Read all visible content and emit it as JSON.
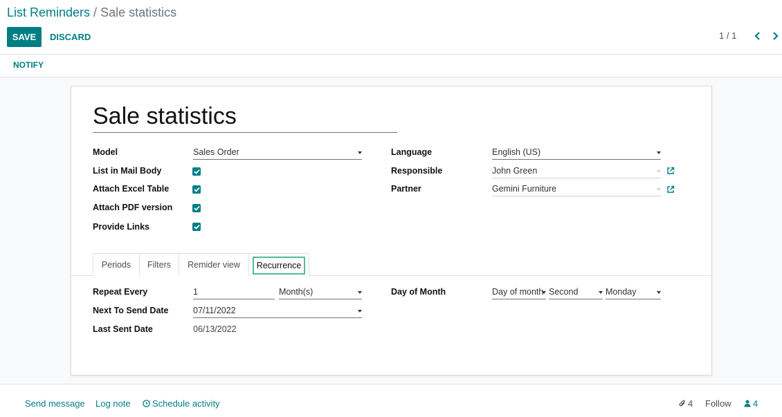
{
  "breadcrumb": {
    "parent": "List Reminders",
    "separator": " / ",
    "current": "Sale statistics"
  },
  "toolbar": {
    "save_label": "SAVE",
    "discard_label": "DISCARD"
  },
  "pager": {
    "value": "1 / 1"
  },
  "statusbar": {
    "notify_label": "NOTIFY"
  },
  "record": {
    "name": "Sale statistics",
    "fields": {
      "model": {
        "label": "Model",
        "value": "Sales Order"
      },
      "list_in_mail_body": {
        "label": "List in Mail Body",
        "checked": true
      },
      "attach_excel_table": {
        "label": "Attach Excel Table",
        "checked": true
      },
      "attach_pdf_version": {
        "label": "Attach PDF version",
        "checked": true
      },
      "provide_links": {
        "label": "Provide Links",
        "checked": true
      },
      "language": {
        "label": "Language",
        "value": "English (US)"
      },
      "responsible": {
        "label": "Responsible",
        "value": "John Green"
      },
      "partner": {
        "label": "Partner",
        "value": "Gemini Furniture"
      }
    }
  },
  "tabs": [
    {
      "label": "Periods"
    },
    {
      "label": "Filters"
    },
    {
      "label": "Remider view"
    },
    {
      "label": "Recurrence",
      "active": true
    }
  ],
  "recurrence": {
    "repeat_every": {
      "label": "Repeat Every",
      "number": "1",
      "unit": "Month(s)"
    },
    "next_to_send_date": {
      "label": "Next To Send Date",
      "value": "07/11/2022"
    },
    "last_sent_date": {
      "label": "Last Sent Date",
      "value": "06/13/2022"
    },
    "day_of_month": {
      "label": "Day of Month",
      "mode": "Day of month",
      "ordinal": "Second",
      "weekday": "Monday"
    }
  },
  "chatter": {
    "send_message": "Send message",
    "log_note": "Log note",
    "schedule_activity": "Schedule activity",
    "attachments_count": "4",
    "follow_label": "Follow",
    "followers_count": "4"
  },
  "colors": {
    "accent": "#017e84",
    "active_tab_border": "#4fbb9c"
  }
}
